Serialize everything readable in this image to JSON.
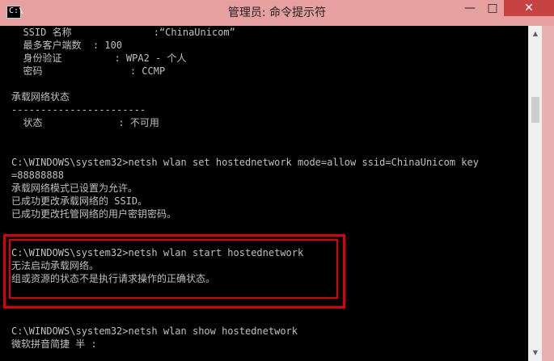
{
  "window": {
    "title": "管理员: 命令提示符",
    "icon_label": "C:\\",
    "controls": {
      "minimize": "—",
      "maximize": "□",
      "close": "✕"
    }
  },
  "console": {
    "lines": [
      "  SSID 名称              :“ChinaUnicom”",
      "  最多客户端数  : 100",
      "  身份验证         : WPA2 - 个人",
      "  密码               : CCMP",
      "",
      "承载网络状态",
      "-----------------------",
      "  状态             : 不可用",
      "",
      "C:\\WINDOWS\\system32>netsh wlan set hostednetwork mode=allow ssid=ChinaUnicom key",
      "=88888888",
      "承载网络模式已设置为允许。",
      "已成功更改承载网络的 SSID。",
      "已成功更改托管网络的用户密钥密码。",
      "",
      "",
      "C:\\WINDOWS\\system32>netsh wlan start hostednetwork",
      "无法启动承载网络。",
      "组或资源的状态不是执行请求操作的正确状态。",
      "",
      "",
      "",
      "C:\\WINDOWS\\system32>netsh wlan show hostednetwork",
      "微软拼音简捷 半 :"
    ]
  },
  "colors": {
    "titlebar": "#e7a0a0",
    "console_bg": "#000000",
    "console_text": "#c0c0c0",
    "highlight": "#e00000"
  },
  "icons": {
    "app": "cmd-icon",
    "scroll_up": "scroll-up-icon",
    "scroll_down": "scroll-down-icon"
  }
}
